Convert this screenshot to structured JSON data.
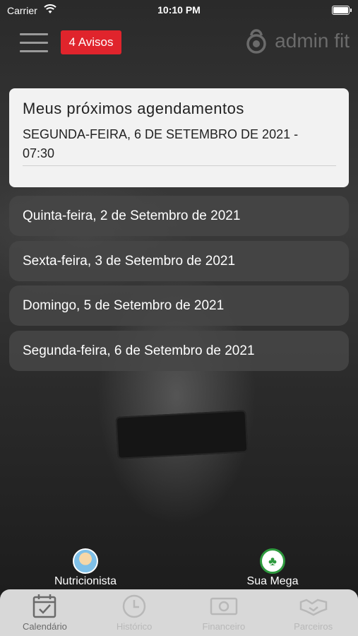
{
  "status_bar": {
    "carrier": "Carrier",
    "time": "10:10 PM"
  },
  "header": {
    "notices_label": "4 Avisos",
    "logo_text": "admin fit"
  },
  "next_appointments": {
    "title": "Meus próximos agendamentos",
    "date_line": "SEGUNDA-FEIRA, 6 DE SETEMBRO DE 2021 -",
    "time_line": "07:30"
  },
  "days": [
    {
      "label": "Quinta-feira, 2 de Setembro de 2021"
    },
    {
      "label": "Sexta-feira, 3 de Setembro de 2021"
    },
    {
      "label": "Domingo, 5 de Setembro de 2021"
    },
    {
      "label": "Segunda-feira, 6 de Setembro de 2021"
    }
  ],
  "shortcuts": {
    "nutritionist": "Nutricionista",
    "mega": "Sua Mega"
  },
  "tabs": [
    {
      "label": "Calendário",
      "icon": "calendar-check-icon",
      "active": true
    },
    {
      "label": "Histórico",
      "icon": "clock-icon",
      "active": false
    },
    {
      "label": "Financeiro",
      "icon": "banknote-icon",
      "active": false
    },
    {
      "label": "Parceiros",
      "icon": "handshake-icon",
      "active": false
    }
  ],
  "colors": {
    "notice_badge": "#e0242c",
    "card_bg": "#f2f2f2",
    "tabbar_bg": "#d8d8d8"
  }
}
